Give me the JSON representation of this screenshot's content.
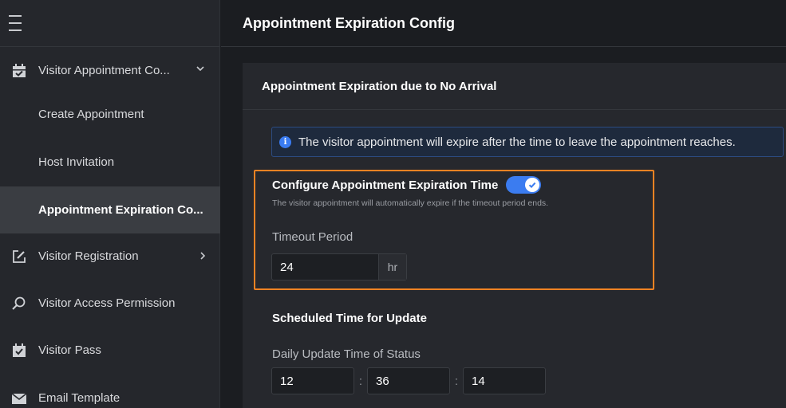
{
  "header": {
    "title": "Appointment Expiration Config"
  },
  "sidebar": {
    "items": [
      {
        "label": "Visitor Appointment Co...",
        "icon": "calendar-check-icon"
      },
      {
        "label": "Create Appointment"
      },
      {
        "label": "Host Invitation"
      },
      {
        "label": "Appointment Expiration Co...",
        "active": true
      },
      {
        "label": "Visitor Registration",
        "icon": "edit-icon"
      },
      {
        "label": "Visitor Access Permission",
        "icon": "search-icon"
      },
      {
        "label": "Visitor Pass",
        "icon": "pass-icon"
      },
      {
        "label": "Email Template",
        "icon": "mail-icon"
      }
    ]
  },
  "card": {
    "title": "Appointment Expiration due to No Arrival",
    "info": "The visitor appointment will expire after the time to leave the appointment reaches.",
    "config": {
      "title": "Configure Appointment Expiration Time",
      "enabled": true,
      "description": "The visitor appointment will automatically expire if the timeout period ends."
    },
    "timeout": {
      "label": "Timeout Period",
      "value": "24",
      "unit": "hr"
    },
    "schedule": {
      "title": "Scheduled Time for Update",
      "daily_label": "Daily Update Time of Status",
      "hour": "12",
      "minute": "36",
      "second": "14",
      "separator": ":"
    }
  },
  "colors": {
    "accent": "#3b7cf0",
    "highlight": "#f08323",
    "active_bg": "#3a3d42"
  }
}
